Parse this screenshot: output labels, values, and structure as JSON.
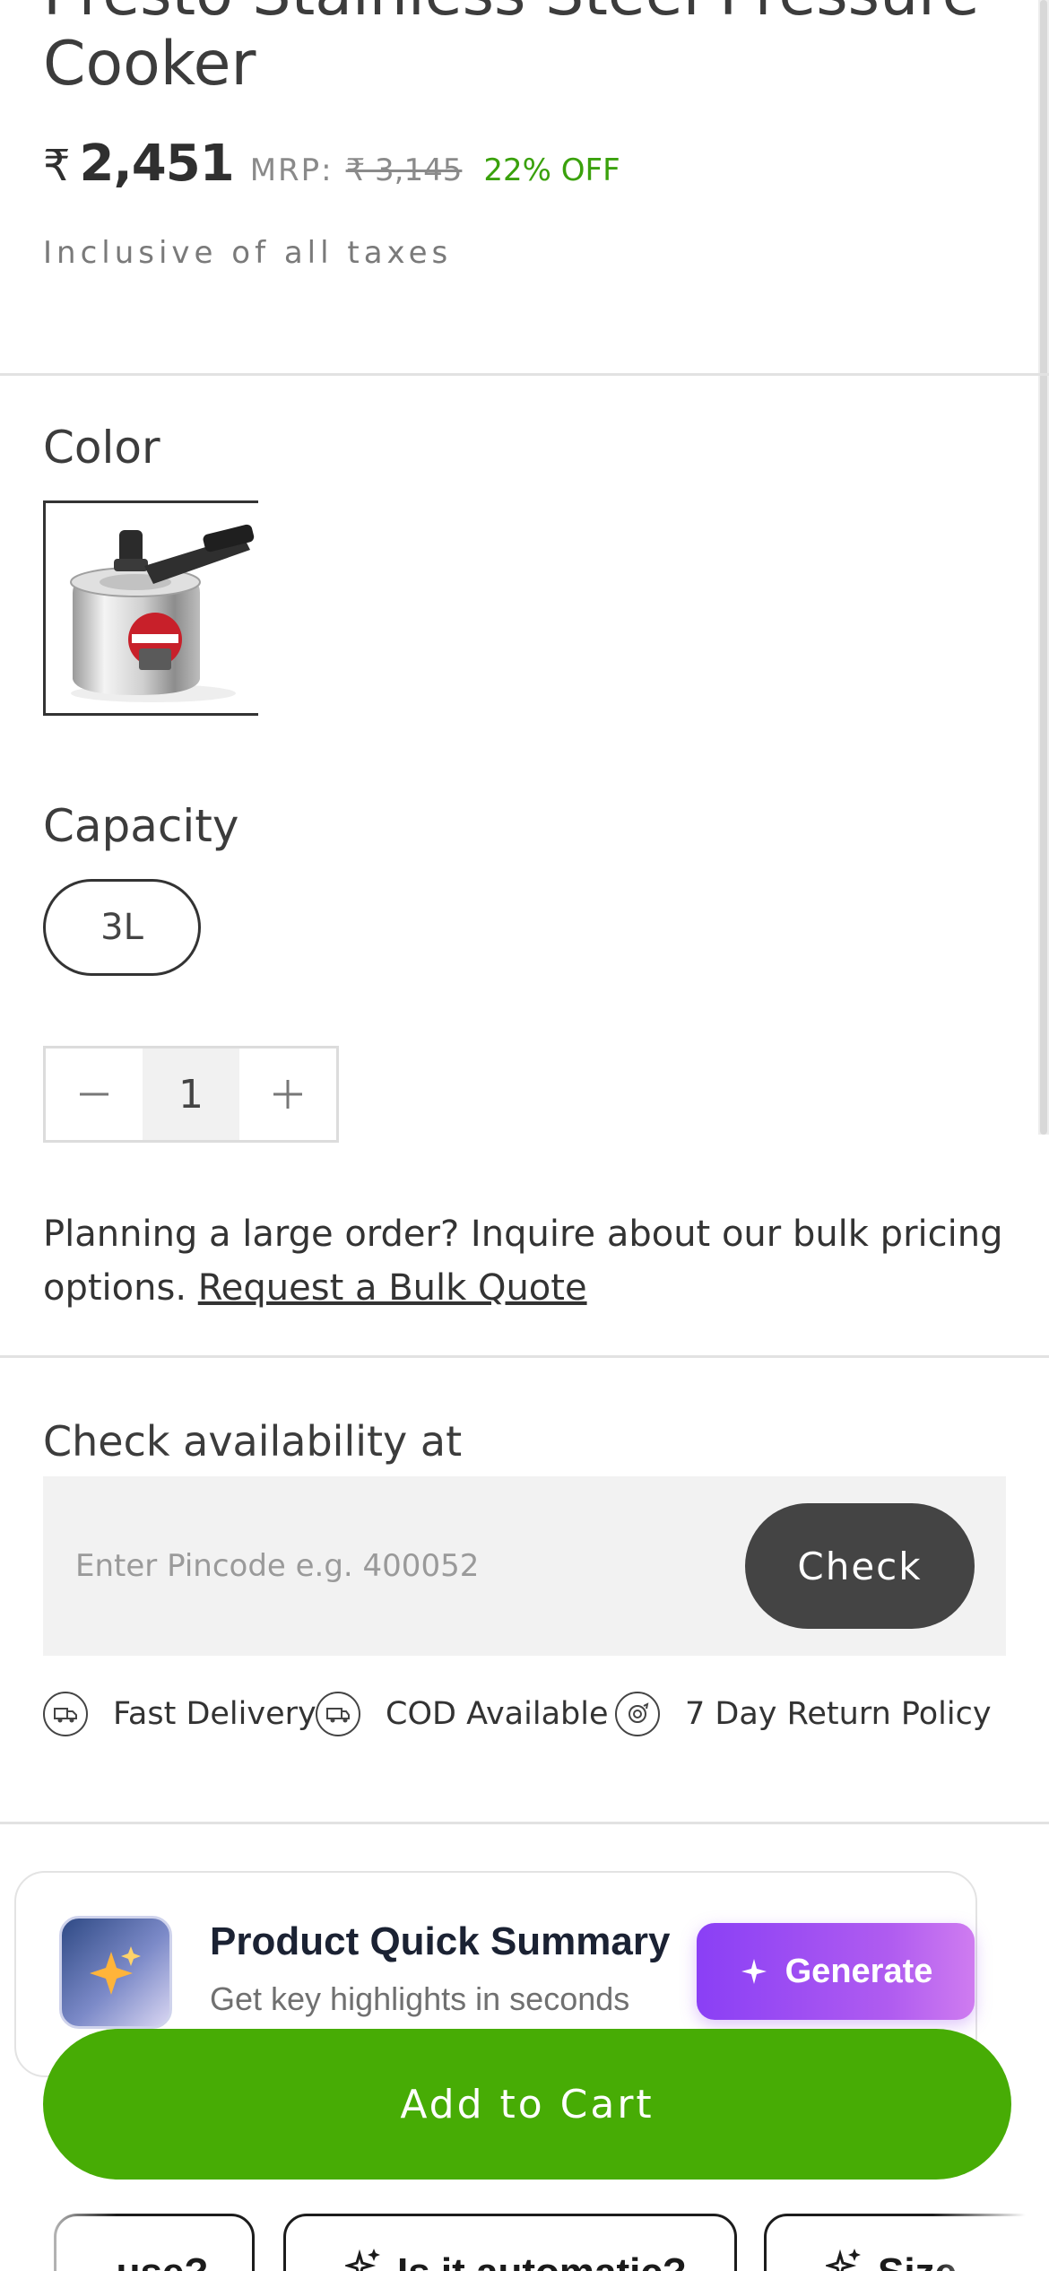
{
  "product": {
    "title_line1": "Presto Stainless Steel Pressure",
    "title_line2": "Cooker",
    "currency_symbol": "₹",
    "price": "2,451",
    "mrp_label": "MRP:",
    "mrp_value": "₹ 3,145",
    "discount": "22% OFF",
    "tax_note": "Inclusive of all taxes"
  },
  "color_section": {
    "label": "Color",
    "selected_swatch": "stainless-steel-cooker"
  },
  "capacity_section": {
    "label": "Capacity",
    "options": [
      "3L"
    ],
    "selected": "3L"
  },
  "quantity": {
    "value": "1",
    "decrement_icon": "minus-icon",
    "increment_icon": "plus-icon"
  },
  "bulk": {
    "text": "Planning a large order? Inquire about our bulk pricing options.",
    "link": "Request a Bulk Quote"
  },
  "availability": {
    "label": "Check availability at",
    "placeholder": "Enter Pincode e.g. 400052",
    "button": "Check"
  },
  "features": [
    {
      "icon": "delivery-truck-icon",
      "label": "Fast Delivery"
    },
    {
      "icon": "cod-icon",
      "label": "COD Available"
    },
    {
      "icon": "return-icon",
      "label": "7 Day Return Policy"
    }
  ],
  "summary": {
    "title": "Product Quick Summary",
    "subtitle": "Get key highlights in seconds",
    "button": "Generate"
  },
  "cart": {
    "button": "Add to Cart"
  },
  "chips": [
    {
      "label": "...use?"
    },
    {
      "label": "Is it automatic?"
    },
    {
      "label": "Size..."
    }
  ],
  "colors": {
    "accent_green": "#47ac05",
    "discount_green": "#3aa10c",
    "check_button": "#444444",
    "generate_purple": "#8a3ff5"
  }
}
